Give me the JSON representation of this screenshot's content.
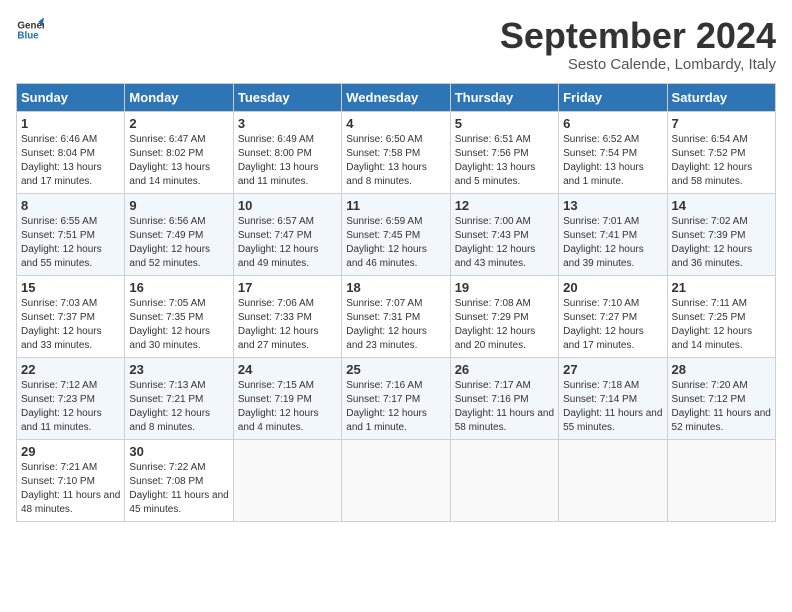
{
  "header": {
    "logo_general": "General",
    "logo_blue": "Blue",
    "month_title": "September 2024",
    "location": "Sesto Calende, Lombardy, Italy"
  },
  "weekdays": [
    "Sunday",
    "Monday",
    "Tuesday",
    "Wednesday",
    "Thursday",
    "Friday",
    "Saturday"
  ],
  "weeks": [
    [
      {
        "day": "1",
        "info": "Sunrise: 6:46 AM\nSunset: 8:04 PM\nDaylight: 13 hours and 17 minutes."
      },
      {
        "day": "2",
        "info": "Sunrise: 6:47 AM\nSunset: 8:02 PM\nDaylight: 13 hours and 14 minutes."
      },
      {
        "day": "3",
        "info": "Sunrise: 6:49 AM\nSunset: 8:00 PM\nDaylight: 13 hours and 11 minutes."
      },
      {
        "day": "4",
        "info": "Sunrise: 6:50 AM\nSunset: 7:58 PM\nDaylight: 13 hours and 8 minutes."
      },
      {
        "day": "5",
        "info": "Sunrise: 6:51 AM\nSunset: 7:56 PM\nDaylight: 13 hours and 5 minutes."
      },
      {
        "day": "6",
        "info": "Sunrise: 6:52 AM\nSunset: 7:54 PM\nDaylight: 13 hours and 1 minute."
      },
      {
        "day": "7",
        "info": "Sunrise: 6:54 AM\nSunset: 7:52 PM\nDaylight: 12 hours and 58 minutes."
      }
    ],
    [
      {
        "day": "8",
        "info": "Sunrise: 6:55 AM\nSunset: 7:51 PM\nDaylight: 12 hours and 55 minutes."
      },
      {
        "day": "9",
        "info": "Sunrise: 6:56 AM\nSunset: 7:49 PM\nDaylight: 12 hours and 52 minutes."
      },
      {
        "day": "10",
        "info": "Sunrise: 6:57 AM\nSunset: 7:47 PM\nDaylight: 12 hours and 49 minutes."
      },
      {
        "day": "11",
        "info": "Sunrise: 6:59 AM\nSunset: 7:45 PM\nDaylight: 12 hours and 46 minutes."
      },
      {
        "day": "12",
        "info": "Sunrise: 7:00 AM\nSunset: 7:43 PM\nDaylight: 12 hours and 43 minutes."
      },
      {
        "day": "13",
        "info": "Sunrise: 7:01 AM\nSunset: 7:41 PM\nDaylight: 12 hours and 39 minutes."
      },
      {
        "day": "14",
        "info": "Sunrise: 7:02 AM\nSunset: 7:39 PM\nDaylight: 12 hours and 36 minutes."
      }
    ],
    [
      {
        "day": "15",
        "info": "Sunrise: 7:03 AM\nSunset: 7:37 PM\nDaylight: 12 hours and 33 minutes."
      },
      {
        "day": "16",
        "info": "Sunrise: 7:05 AM\nSunset: 7:35 PM\nDaylight: 12 hours and 30 minutes."
      },
      {
        "day": "17",
        "info": "Sunrise: 7:06 AM\nSunset: 7:33 PM\nDaylight: 12 hours and 27 minutes."
      },
      {
        "day": "18",
        "info": "Sunrise: 7:07 AM\nSunset: 7:31 PM\nDaylight: 12 hours and 23 minutes."
      },
      {
        "day": "19",
        "info": "Sunrise: 7:08 AM\nSunset: 7:29 PM\nDaylight: 12 hours and 20 minutes."
      },
      {
        "day": "20",
        "info": "Sunrise: 7:10 AM\nSunset: 7:27 PM\nDaylight: 12 hours and 17 minutes."
      },
      {
        "day": "21",
        "info": "Sunrise: 7:11 AM\nSunset: 7:25 PM\nDaylight: 12 hours and 14 minutes."
      }
    ],
    [
      {
        "day": "22",
        "info": "Sunrise: 7:12 AM\nSunset: 7:23 PM\nDaylight: 12 hours and 11 minutes."
      },
      {
        "day": "23",
        "info": "Sunrise: 7:13 AM\nSunset: 7:21 PM\nDaylight: 12 hours and 8 minutes."
      },
      {
        "day": "24",
        "info": "Sunrise: 7:15 AM\nSunset: 7:19 PM\nDaylight: 12 hours and 4 minutes."
      },
      {
        "day": "25",
        "info": "Sunrise: 7:16 AM\nSunset: 7:17 PM\nDaylight: 12 hours and 1 minute."
      },
      {
        "day": "26",
        "info": "Sunrise: 7:17 AM\nSunset: 7:16 PM\nDaylight: 11 hours and 58 minutes."
      },
      {
        "day": "27",
        "info": "Sunrise: 7:18 AM\nSunset: 7:14 PM\nDaylight: 11 hours and 55 minutes."
      },
      {
        "day": "28",
        "info": "Sunrise: 7:20 AM\nSunset: 7:12 PM\nDaylight: 11 hours and 52 minutes."
      }
    ],
    [
      {
        "day": "29",
        "info": "Sunrise: 7:21 AM\nSunset: 7:10 PM\nDaylight: 11 hours and 48 minutes."
      },
      {
        "day": "30",
        "info": "Sunrise: 7:22 AM\nSunset: 7:08 PM\nDaylight: 11 hours and 45 minutes."
      },
      {
        "day": "",
        "info": ""
      },
      {
        "day": "",
        "info": ""
      },
      {
        "day": "",
        "info": ""
      },
      {
        "day": "",
        "info": ""
      },
      {
        "day": "",
        "info": ""
      }
    ]
  ]
}
